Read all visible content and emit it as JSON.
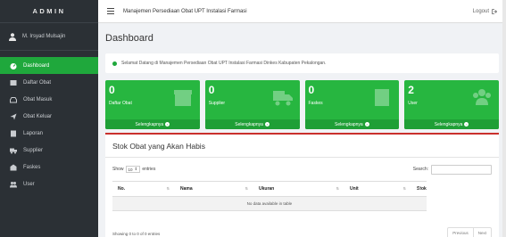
{
  "sidebar": {
    "brand": "ADMIN",
    "user_name": "M. Irsyad Mulsajin",
    "items": [
      {
        "label": "Dashboard",
        "icon": "dashboard-icon",
        "active": true
      },
      {
        "label": "Daftar Obat",
        "icon": "list-icon",
        "active": false
      },
      {
        "label": "Obat Masuk",
        "icon": "inbox-icon",
        "active": false
      },
      {
        "label": "Obat Keluar",
        "icon": "send-icon",
        "active": false
      },
      {
        "label": "Laporan",
        "icon": "report-icon",
        "active": false
      },
      {
        "label": "Supplier",
        "icon": "truck-icon",
        "active": false
      },
      {
        "label": "Faskes",
        "icon": "building-icon",
        "active": false
      },
      {
        "label": "User",
        "icon": "users-icon",
        "active": false
      }
    ]
  },
  "topbar": {
    "title": "Manajemen Persediaan Obat UPT Instalasi Farmasi",
    "logout_label": "Logout"
  },
  "main": {
    "page_title": "Dashboard",
    "alert_text": "Selamat Datang di Manajemen Persediaan Obat UPT Instalasi Farmasi Dinkes Kabupaten Pekalongan.",
    "cards": [
      {
        "value": "0",
        "label": "Daftar Obat",
        "link": "Selengkapnya",
        "icon": "box-icon"
      },
      {
        "value": "0",
        "label": "Supplier",
        "link": "Selengkapnya",
        "icon": "truck-icon"
      },
      {
        "value": "0",
        "label": "Faskes",
        "link": "Selengkapnya",
        "icon": "building-icon"
      },
      {
        "value": "2",
        "label": "User",
        "link": "Selengkapnya",
        "icon": "users-icon"
      }
    ],
    "panel": {
      "title": "Stok Obat yang Akan Habis",
      "show_label": "Show",
      "show_value": "10",
      "entries_label": "entries",
      "search_label": "Search:",
      "columns": [
        "No.",
        "Nama",
        "Ukuran",
        "Unit",
        "Stok"
      ],
      "empty_text": "No data available in table",
      "info_text": "Showing 0 to 0 of 0 entries",
      "prev_label": "Previous",
      "next_label": "Next"
    }
  },
  "colors": {
    "accent": "#27b640",
    "sidebar_bg": "#2b3035",
    "panel_border": "#c9302c"
  }
}
